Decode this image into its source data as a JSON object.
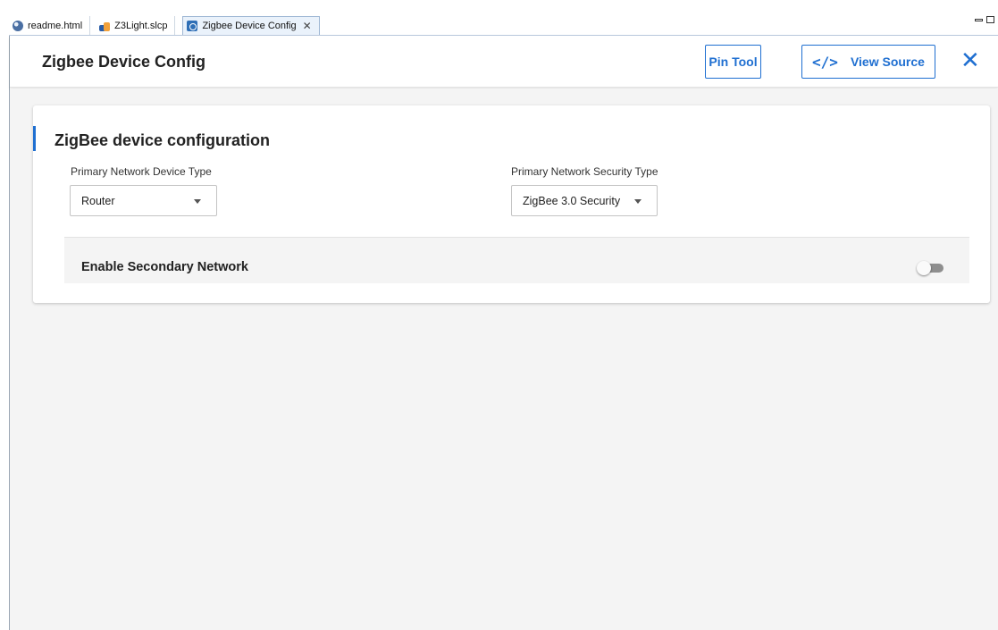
{
  "tabs": [
    {
      "label": "readme.html",
      "icon": "globe-icon"
    },
    {
      "label": "Z3Light.slcp",
      "icon": "project-icon"
    },
    {
      "label": "Zigbee Device Config",
      "icon": "config-icon",
      "active": true
    }
  ],
  "header": {
    "title": "Zigbee Device Config",
    "pin_tool_label": "Pin Tool",
    "view_source_label": "View Source",
    "view_source_icon": "</>",
    "close_glyph": "✕"
  },
  "card": {
    "title": "ZigBee device configuration",
    "device_type": {
      "label": "Primary Network Device Type",
      "value": "Router"
    },
    "security_type": {
      "label": "Primary Network Security Type",
      "value": "ZigBee 3.0 Security"
    },
    "secondary_network": {
      "label": "Enable Secondary Network",
      "enabled": false
    }
  },
  "colors": {
    "accent": "#1f6fd1",
    "background": "#f4f4f4"
  }
}
